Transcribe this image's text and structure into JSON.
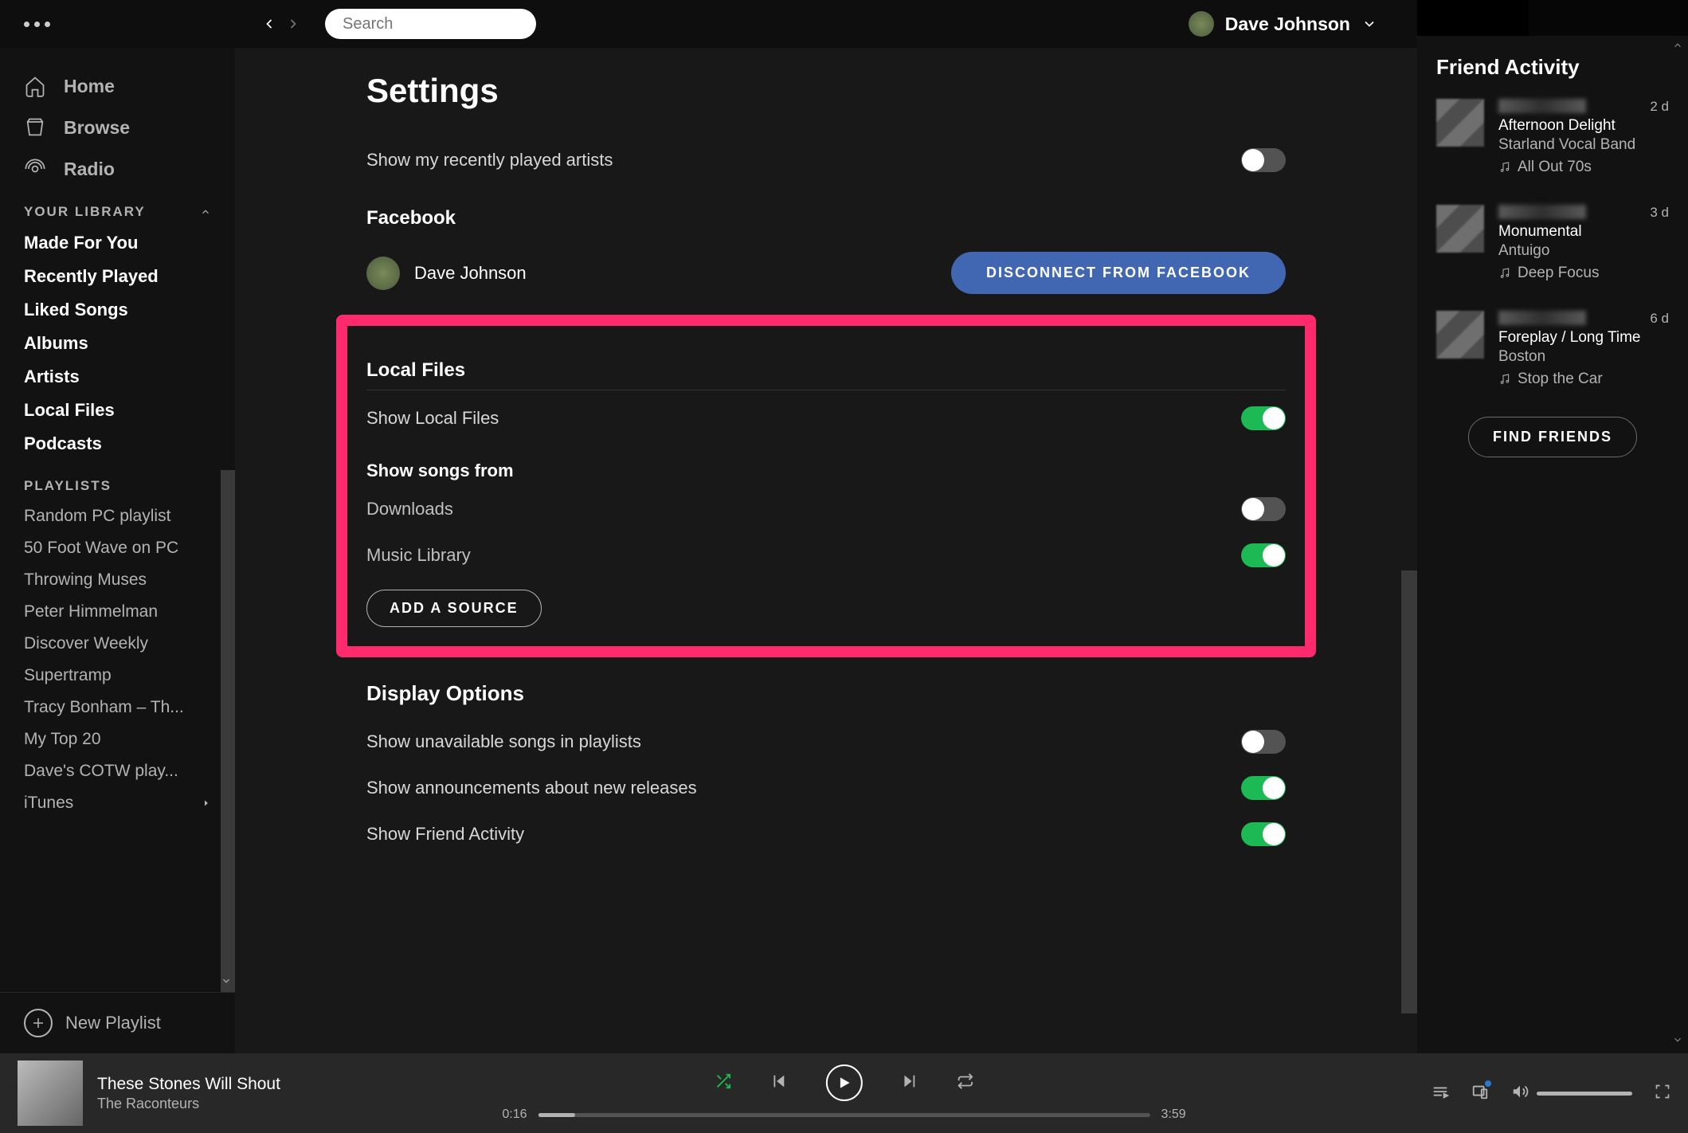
{
  "topbar": {
    "search_placeholder": "Search",
    "username": "Dave Johnson"
  },
  "sidebar": {
    "nav": [
      {
        "label": "Home"
      },
      {
        "label": "Browse"
      },
      {
        "label": "Radio"
      }
    ],
    "library_header": "YOUR LIBRARY",
    "library": [
      "Made For You",
      "Recently Played",
      "Liked Songs",
      "Albums",
      "Artists",
      "Local Files",
      "Podcasts"
    ],
    "playlists_header": "PLAYLISTS",
    "playlists": [
      "Random PC playlist",
      "50 Foot Wave on PC",
      "Throwing Muses",
      "Peter Himmelman",
      "Discover Weekly",
      "Supertramp",
      "Tracy Bonham – Th...",
      "My Top 20",
      "Dave's COTW play...",
      "iTunes"
    ],
    "new_playlist": "New Playlist"
  },
  "settings": {
    "title": "Settings",
    "show_recent_artists": "Show my recently played artists",
    "facebook_header": "Facebook",
    "facebook_name": "Dave Johnson",
    "facebook_disconnect": "DISCONNECT FROM FACEBOOK",
    "local_files_header": "Local Files",
    "show_local_files": "Show Local Files",
    "show_songs_from": "Show songs from",
    "downloads": "Downloads",
    "music_library": "Music Library",
    "add_source": "ADD A SOURCE",
    "display_options_header": "Display Options",
    "show_unavailable": "Show unavailable songs in playlists",
    "show_announcements": "Show announcements about new releases",
    "show_friend_activity": "Show Friend Activity"
  },
  "friends": {
    "header": "Friend Activity",
    "items": [
      {
        "track": "Afternoon Delight",
        "artist": "Starland Vocal Band",
        "playlist": "All Out 70s",
        "ago": "2 d"
      },
      {
        "track": "Monumental",
        "artist": "Antuigo",
        "playlist": "Deep Focus",
        "ago": "3 d"
      },
      {
        "track": "Foreplay / Long Time",
        "artist": "Boston",
        "playlist": "Stop the Car",
        "ago": "6 d"
      }
    ],
    "find_label": "FIND FRIENDS"
  },
  "player": {
    "track": "These Stones Will Shout",
    "artist": "The Raconteurs",
    "elapsed": "0:16",
    "total": "3:59"
  }
}
